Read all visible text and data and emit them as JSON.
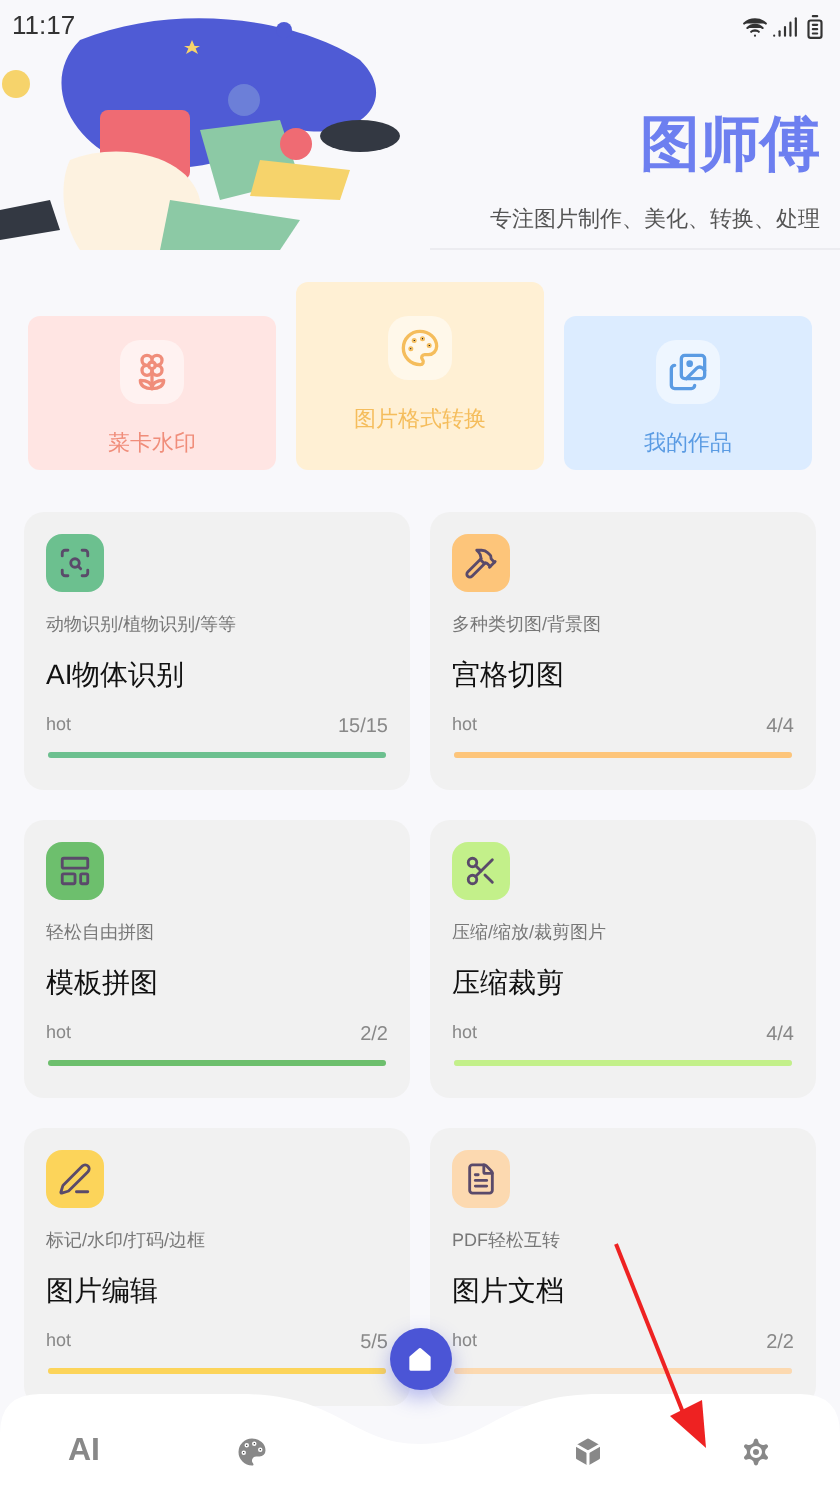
{
  "status_bar": {
    "time": "11:17"
  },
  "header": {
    "title": "图师傅",
    "subtitle": "专注图片制作、美化、转换、处理"
  },
  "quick_actions": [
    {
      "label": "菜卡水印",
      "selected": false,
      "color": "#f08d7a",
      "kind": "flower"
    },
    {
      "label": "图片格式转换",
      "selected": true,
      "color": "#f5bd5c",
      "kind": "palette"
    },
    {
      "label": "我的作品",
      "selected": false,
      "color": "#5a9be3",
      "kind": "gallery"
    }
  ],
  "tools": [
    {
      "kind": "scan",
      "caption": "动物识别/植物识别/等等",
      "title": "AI物体识别",
      "tag": "hot",
      "count": "15/15",
      "level": 1,
      "color": "#6cc08f"
    },
    {
      "kind": "hammer",
      "caption": "多种类切图/背景图",
      "title": "宫格切图",
      "tag": "hot",
      "count": "4/4",
      "level": 1,
      "color": "#fdc57a"
    },
    {
      "kind": "template",
      "caption": "轻松自由拼图",
      "title": "模板拼图",
      "tag": "hot",
      "count": "2/2",
      "level": 1,
      "color": "#6dbf6d"
    },
    {
      "kind": "scissors",
      "caption": "压缩/缩放/裁剪图片",
      "title": "压缩裁剪",
      "tag": "hot",
      "count": "4/4",
      "level": 1,
      "color": "#c3f08a"
    },
    {
      "kind": "pen",
      "caption": "标记/水印/打码/边框",
      "title": "图片编辑",
      "tag": "hot",
      "count": "5/5",
      "level": 1,
      "color": "#fcd45a"
    },
    {
      "kind": "document",
      "caption": "PDF轻松互转",
      "title": "图片文档",
      "tag": "hot",
      "count": "2/2",
      "level": 1,
      "color": "#fcd9b0"
    }
  ],
  "nav": [
    {
      "kind": "text",
      "label": "AI",
      "selected": false
    },
    {
      "kind": "palette",
      "selected": false
    },
    {
      "kind": "home",
      "selected": true
    },
    {
      "kind": "box",
      "selected": false
    },
    {
      "kind": "settings",
      "selected": false
    }
  ]
}
